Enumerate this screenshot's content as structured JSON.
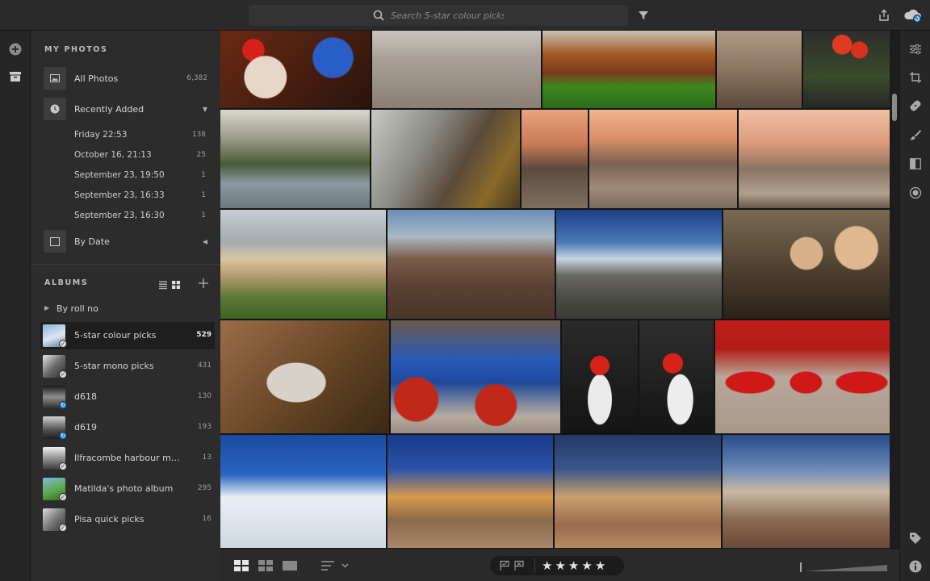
{
  "search": {
    "placeholder": "Search 5-star colour picks"
  },
  "icons": {
    "search": "search-icon",
    "filter": "filter-icon",
    "share": "share-icon",
    "cloud": "cloud-sync-icon",
    "add": "add-icon",
    "library": "library-icon",
    "edit": "sliders-icon",
    "crop": "crop-icon",
    "heal": "healing-icon",
    "brush": "brush-icon",
    "gradient": "linear-gradient-icon",
    "radial": "radial-gradient-icon",
    "tag": "keyword-tag-icon",
    "info": "info-icon"
  },
  "sidebar": {
    "my_photos_title": "MY PHOTOS",
    "all_photos": {
      "label": "All Photos",
      "count": "6,382"
    },
    "recently_added": {
      "label": "Recently Added"
    },
    "recent_items": [
      {
        "label": "Friday  22:53",
        "count": "138"
      },
      {
        "label": "October 16, 21:13",
        "count": "25"
      },
      {
        "label": "September 23, 19:50",
        "count": "1"
      },
      {
        "label": "September 23, 16:33",
        "count": "1"
      },
      {
        "label": "September 23, 16:30",
        "count": "1"
      }
    ],
    "by_date": {
      "label": "By Date"
    },
    "albums_title": "ALBUMS",
    "by_roll": {
      "label": "By roll no"
    },
    "albums": [
      {
        "label": "5-star colour picks",
        "count": "529"
      },
      {
        "label": "5-star mono picks",
        "count": "431"
      },
      {
        "label": "d618",
        "count": "130"
      },
      {
        "label": "d619",
        "count": "193"
      },
      {
        "label": "Ilfracombe harbour m…",
        "count": "13"
      },
      {
        "label": "Matilda's photo album",
        "count": "295"
      },
      {
        "label": "Pisa quick picks",
        "count": "16"
      }
    ]
  },
  "bottombar": {
    "stars": [
      "★",
      "★",
      "★",
      "★",
      "★"
    ]
  },
  "colors": {
    "accent": "#2a8ce0",
    "panel": "#2c2c2c",
    "grid_bg": "#141414"
  }
}
